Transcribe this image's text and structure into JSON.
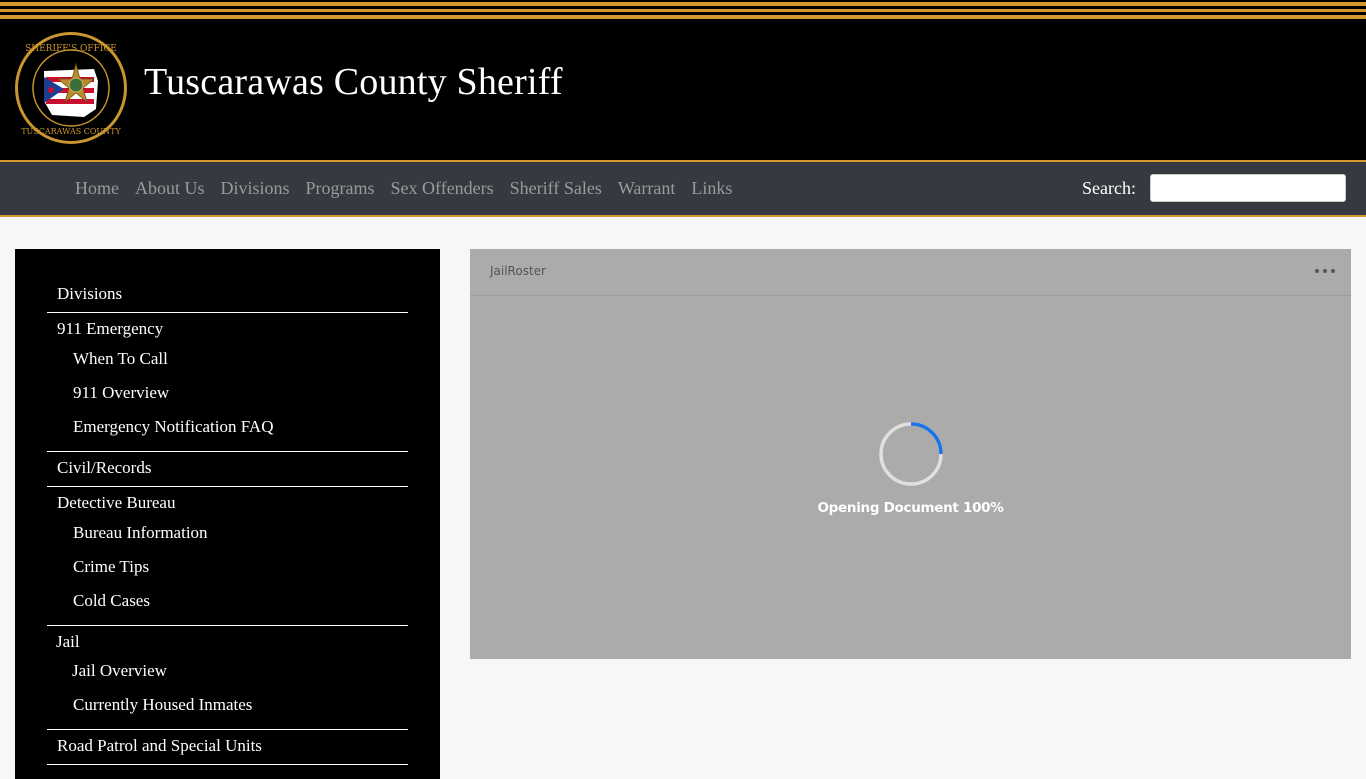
{
  "site": {
    "title": "Tuscarawas County Sheriff",
    "logo_alt": "Sheriff's Office Tuscarawas County seal"
  },
  "colors": {
    "accent_gold": "#d4982e",
    "nav_bg": "#343a40",
    "header_bg": "#000000",
    "spinner_blue": "#1a73e8"
  },
  "nav": {
    "items": [
      {
        "label": "Home"
      },
      {
        "label": "About Us"
      },
      {
        "label": "Divisions"
      },
      {
        "label": "Programs"
      },
      {
        "label": "Sex Offenders"
      },
      {
        "label": "Sheriff Sales"
      },
      {
        "label": "Warrant"
      },
      {
        "label": "Links"
      }
    ],
    "search_label": "Search:",
    "search_value": "",
    "search_placeholder": ""
  },
  "sidebar": {
    "items": [
      {
        "label": "Divisions",
        "level": 0
      },
      {
        "label": "911 Emergency",
        "level": 0
      },
      {
        "label": "When To Call",
        "level": 1
      },
      {
        "label": "911 Overview",
        "level": 1
      },
      {
        "label": "Emergency Notification FAQ",
        "level": 1
      },
      {
        "label": "Civil/Records",
        "level": 0
      },
      {
        "label": "Detective Bureau",
        "level": 0
      },
      {
        "label": "Bureau Information",
        "level": 1
      },
      {
        "label": "Crime Tips",
        "level": 1
      },
      {
        "label": "Cold Cases",
        "level": 1
      },
      {
        "label": "Jail",
        "level": 0
      },
      {
        "label": "Jail Overview",
        "level": 1
      },
      {
        "label": "Currently Housed Inmates",
        "level": 1
      },
      {
        "label": "Road Patrol and Special Units",
        "level": 0
      }
    ]
  },
  "viewer": {
    "document_name": "JailRoster",
    "more_icon": "ellipsis-icon",
    "loading_text": "Opening Document 100%",
    "progress_percent": 100
  }
}
